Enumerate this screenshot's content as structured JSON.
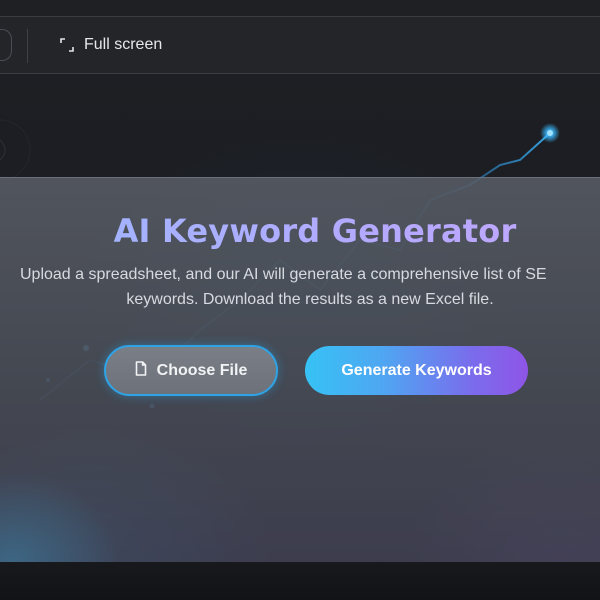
{
  "toolbar": {
    "fullscreen_label": "Full screen"
  },
  "hero": {
    "title": "AI Keyword Generator",
    "subtitle_line1": "Upload a spreadsheet, and our AI will generate a comprehensive list of SE",
    "subtitle_line2": "keywords. Download the results as a new Excel file."
  },
  "actions": {
    "choose_file_label": "Choose File",
    "generate_label": "Generate Keywords"
  },
  "icons": {
    "fullscreen": "expand-corners-icon",
    "file": "document-icon"
  },
  "colors": {
    "title_gradient": [
      "#9db7ff",
      "#c5a6ff"
    ],
    "choose_border": "#2ea3e6",
    "generate_gradient": [
      "#36c2f4",
      "#8f55e6"
    ],
    "accent_dot": "#3ab8ff"
  }
}
